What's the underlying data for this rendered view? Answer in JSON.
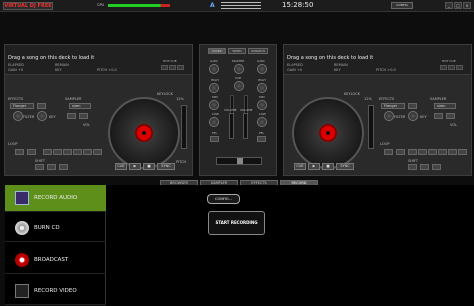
{
  "app": {
    "logo": "VIRTUAL DJ FREE",
    "cpu_label": "CPU",
    "cpu_load": 0.85,
    "mixer_label": "A",
    "clock": "15:28:50",
    "config_label": "CONFIG"
  },
  "window": {
    "min": "_",
    "max": "□",
    "close": "×"
  },
  "deck_left": {
    "song_title": "Drag a song on this deck to load it",
    "elapsed": "ELAPSED",
    "remain": "REMAIN",
    "gain": "GAIN +0",
    "key": "KEY",
    "pitch": "PITCH +0.0",
    "hotcue": "HOT CUE",
    "hotcue_nums": [
      "1",
      "2",
      "3"
    ],
    "effects": "EFFECTS",
    "effect_sel": "Flanger",
    "sampler": "SAMPLER",
    "sampler_sel": "siren",
    "filter": "FILTER",
    "key_lbl": "KEY",
    "vol": "VOL",
    "loop": "LOOP",
    "loop_vals": [
      "1",
      "2",
      "4",
      "8",
      "16",
      "32"
    ],
    "shift": "SHIFT",
    "in": "IN",
    "out": "OUT",
    "keylock": "KEYLOCK",
    "keylock_pct": "12%",
    "pitch_lbl": "PITCH",
    "cue": "CUE",
    "play": "▶",
    "stop": "■",
    "sync": "SYNC",
    "pitch_zero": "0"
  },
  "deck_right": {
    "song_title": "Drag a song on this deck to load it",
    "elapsed": "ELAPSED",
    "remain": "REMAIN",
    "gain": "GAIN +0",
    "key": "KEY",
    "pitch": "PITCH +0.0",
    "hotcue": "HOT CUE",
    "hotcue_nums": [
      "1",
      "2",
      "3"
    ],
    "effects": "EFFECTS",
    "effect_sel": "Flanger",
    "sampler": "SAMPLER",
    "sampler_sel": "siren",
    "filter": "FILTER",
    "key_lbl": "KEY",
    "vol": "VOL",
    "loop": "LOOP",
    "loop_vals": [
      "1",
      "2",
      "4",
      "8",
      "16",
      "32"
    ],
    "shift": "SHIFT",
    "in": "IN",
    "out": "OUT",
    "keylock": "KEYLOCK",
    "keylock_pct": "12%",
    "pitch_lbl": "PITCH",
    "cue": "CUE",
    "play": "▶",
    "stop": "■",
    "sync": "SYNC",
    "pitch_zero": "0"
  },
  "mixer": {
    "tabs": [
      "MIXER",
      "VIDEO",
      "SCRATCH"
    ],
    "gain": "GAIN",
    "master": "MASTER",
    "cue": "CUE",
    "high": "HIGH",
    "mid": "MID",
    "low": "LOW",
    "volume": "VOLUME",
    "pfl": "PFL"
  },
  "bottom_tabs": [
    "BROWSER",
    "SAMPLER",
    "EFFECTS",
    "RECORD"
  ],
  "left_menu": [
    {
      "label": "RECORD AUDIO",
      "icon": "floppy-disk-icon"
    },
    {
      "label": "BURN CD",
      "icon": "cd-disc-icon"
    },
    {
      "label": "BROADCAST",
      "icon": "broadcast-icon"
    },
    {
      "label": "RECORD VIDEO",
      "icon": "video-camera-icon"
    }
  ],
  "record": {
    "config_button": "CONFIG...",
    "start_button": "START RECORDING"
  }
}
